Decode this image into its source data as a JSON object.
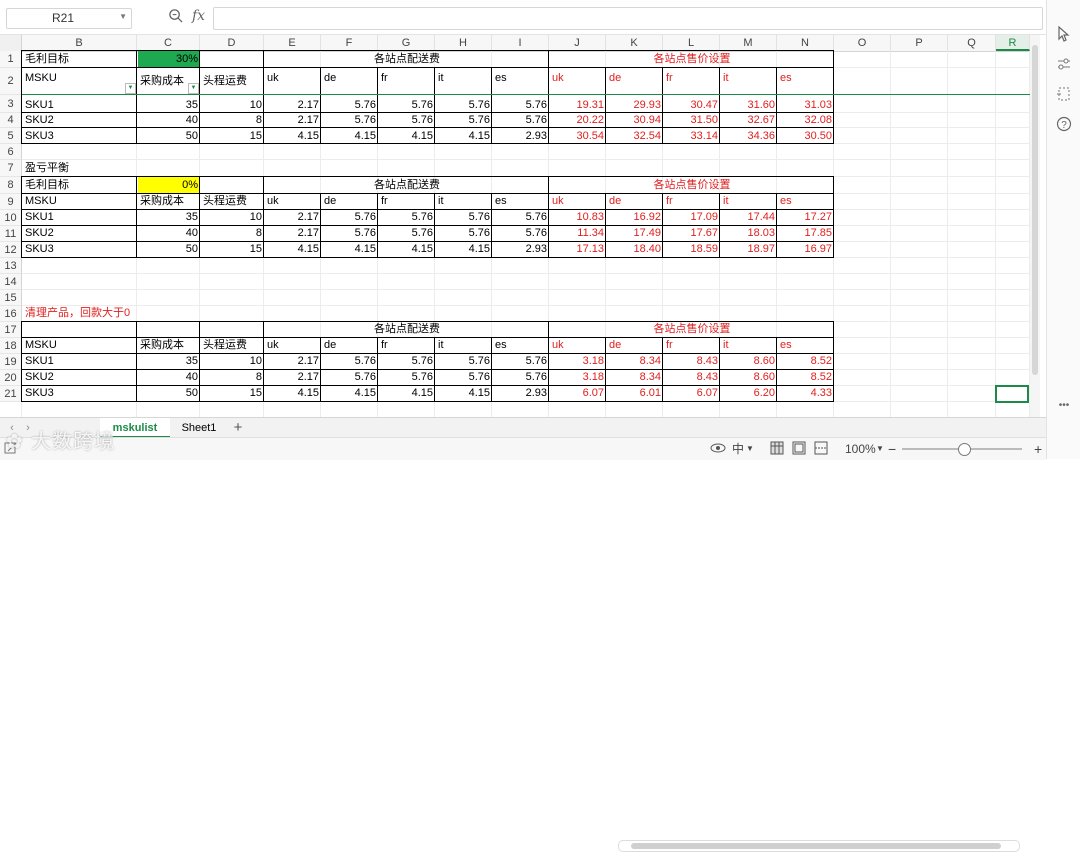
{
  "toolbar": {
    "name_box": "R21",
    "fx_label": "fx",
    "formula_value": ""
  },
  "columns": [
    "B",
    "C",
    "D",
    "E",
    "F",
    "G",
    "H",
    "I",
    "J",
    "K",
    "L",
    "M",
    "N",
    "O",
    "P",
    "Q",
    "R"
  ],
  "selected_column": "R",
  "rows": [
    "1",
    "2",
    "3",
    "4",
    "5",
    "6",
    "7",
    "8",
    "9",
    "10",
    "11",
    "12",
    "13",
    "14",
    "15",
    "16",
    "17",
    "18",
    "19",
    "20",
    "21"
  ],
  "colors": {
    "green_fill": "#1ea84f",
    "yellow_fill": "#ffff00",
    "accent": "#1e8a4a",
    "red_text": "#e02020"
  },
  "block1": {
    "target_label": "毛利目标",
    "target_value": "30%",
    "shipping_header": "各站点配送费",
    "price_header": "各站点售价设置",
    "headers": [
      "MSKU",
      "采购成本",
      "头程运费",
      "uk",
      "de",
      "fr",
      "it",
      "es",
      "uk",
      "de",
      "fr",
      "it",
      "es"
    ],
    "rows": [
      [
        "SKU1",
        "35",
        "10",
        "2.17",
        "5.76",
        "5.76",
        "5.76",
        "5.76",
        "19.31",
        "29.93",
        "30.47",
        "31.60",
        "31.03"
      ],
      [
        "SKU2",
        "40",
        "8",
        "2.17",
        "5.76",
        "5.76",
        "5.76",
        "5.76",
        "20.22",
        "30.94",
        "31.50",
        "32.67",
        "32.08"
      ],
      [
        "SKU3",
        "50",
        "15",
        "4.15",
        "4.15",
        "4.15",
        "4.15",
        "2.93",
        "30.54",
        "32.54",
        "33.14",
        "34.36",
        "30.50"
      ]
    ]
  },
  "section2_title": "盈亏平衡",
  "block2": {
    "target_label": "毛利目标",
    "target_value": "0%",
    "shipping_header": "各站点配送费",
    "price_header": "各站点售价设置",
    "headers": [
      "MSKU",
      "采购成本",
      "头程运费",
      "uk",
      "de",
      "fr",
      "it",
      "es",
      "uk",
      "de",
      "fr",
      "it",
      "es"
    ],
    "rows": [
      [
        "SKU1",
        "35",
        "10",
        "2.17",
        "5.76",
        "5.76",
        "5.76",
        "5.76",
        "10.83",
        "16.92",
        "17.09",
        "17.44",
        "17.27"
      ],
      [
        "SKU2",
        "40",
        "8",
        "2.17",
        "5.76",
        "5.76",
        "5.76",
        "5.76",
        "11.34",
        "17.49",
        "17.67",
        "18.03",
        "17.85"
      ],
      [
        "SKU3",
        "50",
        "15",
        "4.15",
        "4.15",
        "4.15",
        "4.15",
        "2.93",
        "17.13",
        "18.40",
        "18.59",
        "18.97",
        "16.97"
      ]
    ]
  },
  "section3_title": "清理产品，回款大于0",
  "block3": {
    "shipping_header": "各站点配送费",
    "price_header": "各站点售价设置",
    "headers": [
      "MSKU",
      "采购成本",
      "头程运费",
      "uk",
      "de",
      "fr",
      "it",
      "es",
      "uk",
      "de",
      "fr",
      "it",
      "es"
    ],
    "rows": [
      [
        "SKU1",
        "35",
        "10",
        "2.17",
        "5.76",
        "5.76",
        "5.76",
        "5.76",
        "3.18",
        "8.34",
        "8.43",
        "8.60",
        "8.52"
      ],
      [
        "SKU2",
        "40",
        "8",
        "2.17",
        "5.76",
        "5.76",
        "5.76",
        "5.76",
        "3.18",
        "8.34",
        "8.43",
        "8.60",
        "8.52"
      ],
      [
        "SKU3",
        "50",
        "15",
        "4.15",
        "4.15",
        "4.15",
        "4.15",
        "2.93",
        "6.07",
        "6.01",
        "6.07",
        "6.20",
        "4.33"
      ]
    ]
  },
  "tabs": [
    {
      "label": "mskulist",
      "active": true
    },
    {
      "label": "Sheet1",
      "active": false
    }
  ],
  "add_sheet": "+",
  "status": {
    "zoom": "100%",
    "zoom_minus": "−",
    "zoom_plus": "+",
    "input_mode": "中"
  },
  "watermark": "大数跨境"
}
